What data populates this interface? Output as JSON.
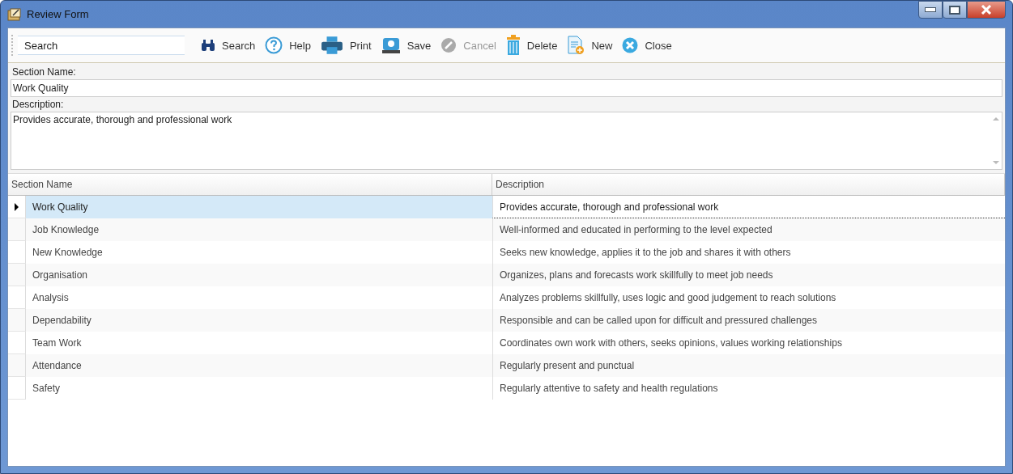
{
  "window": {
    "title": "Review Form"
  },
  "toolbar": {
    "search": {
      "value": "Search"
    },
    "buttons": [
      {
        "kind": "search",
        "label": "Search",
        "disabled": false
      },
      {
        "kind": "help",
        "label": "Help",
        "disabled": false
      },
      {
        "kind": "print",
        "label": "Print",
        "disabled": false
      },
      {
        "kind": "save",
        "label": "Save",
        "disabled": false
      },
      {
        "kind": "cancel",
        "label": "Cancel",
        "disabled": true
      },
      {
        "kind": "delete",
        "label": "Delete",
        "disabled": false
      },
      {
        "kind": "new",
        "label": "New",
        "disabled": false
      },
      {
        "kind": "close",
        "label": "Close",
        "disabled": false
      }
    ]
  },
  "form": {
    "section_name": {
      "label": "Section Name:",
      "value": "Work Quality"
    },
    "description": {
      "label": "Description:",
      "value": "Provides accurate, thorough and professional work"
    }
  },
  "table": {
    "columns": [
      "Section Name",
      "Description"
    ],
    "rows": [
      {
        "cells": [
          "Work Quality",
          "Provides accurate, thorough and professional work"
        ],
        "selected": true
      },
      {
        "cells": [
          "Job Knowledge",
          "Well-informed and educated in performing to the level expected"
        ],
        "selected": false
      },
      {
        "cells": [
          "New Knowledge",
          "Seeks new knowledge, applies it to the job and shares it with others"
        ],
        "selected": false
      },
      {
        "cells": [
          "Organisation",
          "Organizes, plans and forecasts work skillfully to meet job needs"
        ],
        "selected": false
      },
      {
        "cells": [
          "Analysis",
          "Analyzes problems skillfully, uses logic and good judgement to reach solutions"
        ],
        "selected": false
      },
      {
        "cells": [
          "Dependability",
          "Responsible and can be called upon for difficult and pressured challenges"
        ],
        "selected": false
      },
      {
        "cells": [
          "Team Work",
          "Coordinates own work with others, seeks opinions, values working relationships"
        ],
        "selected": false
      },
      {
        "cells": [
          "Attendance",
          "Regularly present and punctual"
        ],
        "selected": false
      },
      {
        "cells": [
          "Safety",
          "Regularly attentive to safety and health regulations"
        ],
        "selected": false
      }
    ]
  }
}
